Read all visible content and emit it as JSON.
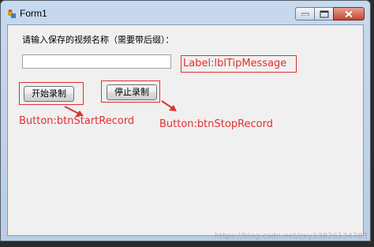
{
  "window": {
    "title": "Form1"
  },
  "form": {
    "prompt_label": "请输入保存的视频名称（需要带后缀）：",
    "video_name_value": "",
    "start_button_label": "开始录制",
    "stop_button_label": "停止录制"
  },
  "annotations": {
    "label_tip": "Label:lblTipMessage",
    "start_button": "Button:btnStartRecord",
    "stop_button": "Button:btnStopRecord"
  },
  "watermark": "https://blog.csdn.net/zxy13826134783",
  "colors": {
    "annotation": "#e03030",
    "titlebar": "#c7d9ee",
    "client_background": "#f0f0f0",
    "close_button": "#c2442d"
  },
  "icons": {
    "app": "form-app-icon",
    "minimize": "minimize-icon",
    "maximize": "maximize-icon",
    "close": "close-icon",
    "annotation_arrow": "arrow-icon"
  }
}
